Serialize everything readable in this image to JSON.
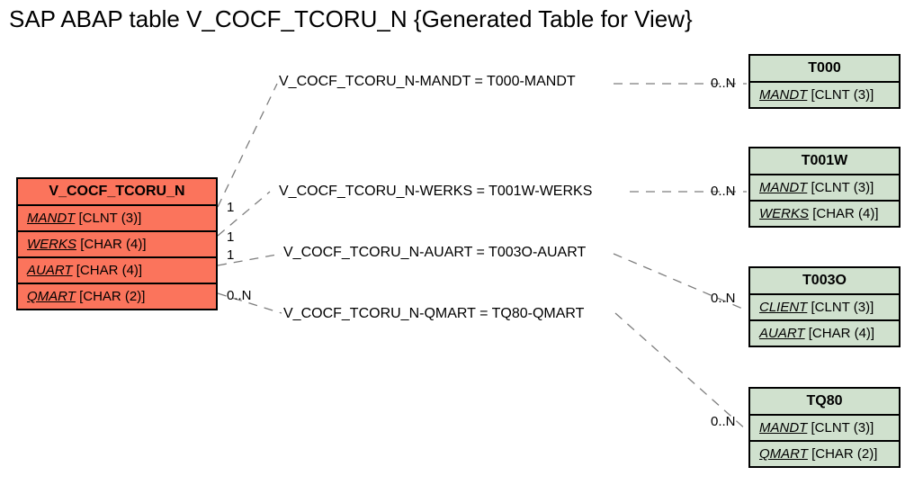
{
  "title": "SAP ABAP table V_COCF_TCORU_N {Generated Table for View}",
  "main_entity": {
    "name": "V_COCF_TCORU_N",
    "fields": [
      {
        "fk": "MANDT",
        "type": "[CLNT (3)]"
      },
      {
        "fk": "WERKS",
        "type": "[CHAR (4)]"
      },
      {
        "fk": "AUART",
        "type": "[CHAR (4)]"
      },
      {
        "fk": "QMART",
        "type": "[CHAR (2)]"
      }
    ]
  },
  "ref_entities": [
    {
      "name": "T000",
      "fields": [
        {
          "fk": "MANDT",
          "type": "[CLNT (3)]"
        }
      ]
    },
    {
      "name": "T001W",
      "fields": [
        {
          "fk": "MANDT",
          "type": "[CLNT (3)]"
        },
        {
          "fk": "WERKS",
          "type": "[CHAR (4)]"
        }
      ]
    },
    {
      "name": "T003O",
      "fields": [
        {
          "fk": "CLIENT",
          "type": "[CLNT (3)]"
        },
        {
          "fk": "AUART",
          "type": "[CHAR (4)]"
        }
      ]
    },
    {
      "name": "TQ80",
      "fields": [
        {
          "fk": "MANDT",
          "type": "[CLNT (3)]"
        },
        {
          "fk": "QMART",
          "type": "[CHAR (2)]"
        }
      ]
    }
  ],
  "relations": [
    {
      "label": "V_COCF_TCORU_N-MANDT = T000-MANDT",
      "left_card": "1",
      "right_card": "0..N"
    },
    {
      "label": "V_COCF_TCORU_N-WERKS = T001W-WERKS",
      "left_card": "1",
      "right_card": "0..N"
    },
    {
      "label": "V_COCF_TCORU_N-AUART = T003O-AUART",
      "left_card": "1",
      "right_card": "0..N"
    },
    {
      "label": "V_COCF_TCORU_N-QMART = TQ80-QMART",
      "left_card": "0..N",
      "right_card": "0..N"
    }
  ]
}
